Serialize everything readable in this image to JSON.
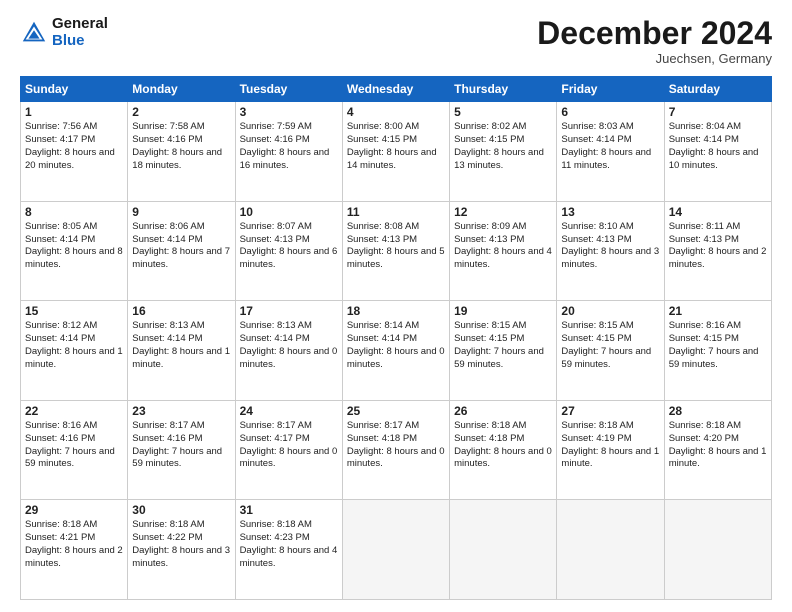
{
  "header": {
    "logo_general": "General",
    "logo_blue": "Blue",
    "month_title": "December 2024",
    "location": "Juechsen, Germany"
  },
  "days_of_week": [
    "Sunday",
    "Monday",
    "Tuesday",
    "Wednesday",
    "Thursday",
    "Friday",
    "Saturday"
  ],
  "weeks": [
    [
      {
        "day": 1,
        "sunrise": "7:56 AM",
        "sunset": "4:17 PM",
        "daylight": "8 hours and 20 minutes."
      },
      {
        "day": 2,
        "sunrise": "7:58 AM",
        "sunset": "4:16 PM",
        "daylight": "8 hours and 18 minutes."
      },
      {
        "day": 3,
        "sunrise": "7:59 AM",
        "sunset": "4:16 PM",
        "daylight": "8 hours and 16 minutes."
      },
      {
        "day": 4,
        "sunrise": "8:00 AM",
        "sunset": "4:15 PM",
        "daylight": "8 hours and 14 minutes."
      },
      {
        "day": 5,
        "sunrise": "8:02 AM",
        "sunset": "4:15 PM",
        "daylight": "8 hours and 13 minutes."
      },
      {
        "day": 6,
        "sunrise": "8:03 AM",
        "sunset": "4:14 PM",
        "daylight": "8 hours and 11 minutes."
      },
      {
        "day": 7,
        "sunrise": "8:04 AM",
        "sunset": "4:14 PM",
        "daylight": "8 hours and 10 minutes."
      }
    ],
    [
      {
        "day": 8,
        "sunrise": "8:05 AM",
        "sunset": "4:14 PM",
        "daylight": "8 hours and 8 minutes."
      },
      {
        "day": 9,
        "sunrise": "8:06 AM",
        "sunset": "4:14 PM",
        "daylight": "8 hours and 7 minutes."
      },
      {
        "day": 10,
        "sunrise": "8:07 AM",
        "sunset": "4:13 PM",
        "daylight": "8 hours and 6 minutes."
      },
      {
        "day": 11,
        "sunrise": "8:08 AM",
        "sunset": "4:13 PM",
        "daylight": "8 hours and 5 minutes."
      },
      {
        "day": 12,
        "sunrise": "8:09 AM",
        "sunset": "4:13 PM",
        "daylight": "8 hours and 4 minutes."
      },
      {
        "day": 13,
        "sunrise": "8:10 AM",
        "sunset": "4:13 PM",
        "daylight": "8 hours and 3 minutes."
      },
      {
        "day": 14,
        "sunrise": "8:11 AM",
        "sunset": "4:13 PM",
        "daylight": "8 hours and 2 minutes."
      }
    ],
    [
      {
        "day": 15,
        "sunrise": "8:12 AM",
        "sunset": "4:14 PM",
        "daylight": "8 hours and 1 minute."
      },
      {
        "day": 16,
        "sunrise": "8:13 AM",
        "sunset": "4:14 PM",
        "daylight": "8 hours and 1 minute."
      },
      {
        "day": 17,
        "sunrise": "8:13 AM",
        "sunset": "4:14 PM",
        "daylight": "8 hours and 0 minutes."
      },
      {
        "day": 18,
        "sunrise": "8:14 AM",
        "sunset": "4:14 PM",
        "daylight": "8 hours and 0 minutes."
      },
      {
        "day": 19,
        "sunrise": "8:15 AM",
        "sunset": "4:15 PM",
        "daylight": "7 hours and 59 minutes."
      },
      {
        "day": 20,
        "sunrise": "8:15 AM",
        "sunset": "4:15 PM",
        "daylight": "7 hours and 59 minutes."
      },
      {
        "day": 21,
        "sunrise": "8:16 AM",
        "sunset": "4:15 PM",
        "daylight": "7 hours and 59 minutes."
      }
    ],
    [
      {
        "day": 22,
        "sunrise": "8:16 AM",
        "sunset": "4:16 PM",
        "daylight": "7 hours and 59 minutes."
      },
      {
        "day": 23,
        "sunrise": "8:17 AM",
        "sunset": "4:16 PM",
        "daylight": "7 hours and 59 minutes."
      },
      {
        "day": 24,
        "sunrise": "8:17 AM",
        "sunset": "4:17 PM",
        "daylight": "8 hours and 0 minutes."
      },
      {
        "day": 25,
        "sunrise": "8:17 AM",
        "sunset": "4:18 PM",
        "daylight": "8 hours and 0 minutes."
      },
      {
        "day": 26,
        "sunrise": "8:18 AM",
        "sunset": "4:18 PM",
        "daylight": "8 hours and 0 minutes."
      },
      {
        "day": 27,
        "sunrise": "8:18 AM",
        "sunset": "4:19 PM",
        "daylight": "8 hours and 1 minute."
      },
      {
        "day": 28,
        "sunrise": "8:18 AM",
        "sunset": "4:20 PM",
        "daylight": "8 hours and 1 minute."
      }
    ],
    [
      {
        "day": 29,
        "sunrise": "8:18 AM",
        "sunset": "4:21 PM",
        "daylight": "8 hours and 2 minutes."
      },
      {
        "day": 30,
        "sunrise": "8:18 AM",
        "sunset": "4:22 PM",
        "daylight": "8 hours and 3 minutes."
      },
      {
        "day": 31,
        "sunrise": "8:18 AM",
        "sunset": "4:23 PM",
        "daylight": "8 hours and 4 minutes."
      },
      null,
      null,
      null,
      null
    ]
  ]
}
